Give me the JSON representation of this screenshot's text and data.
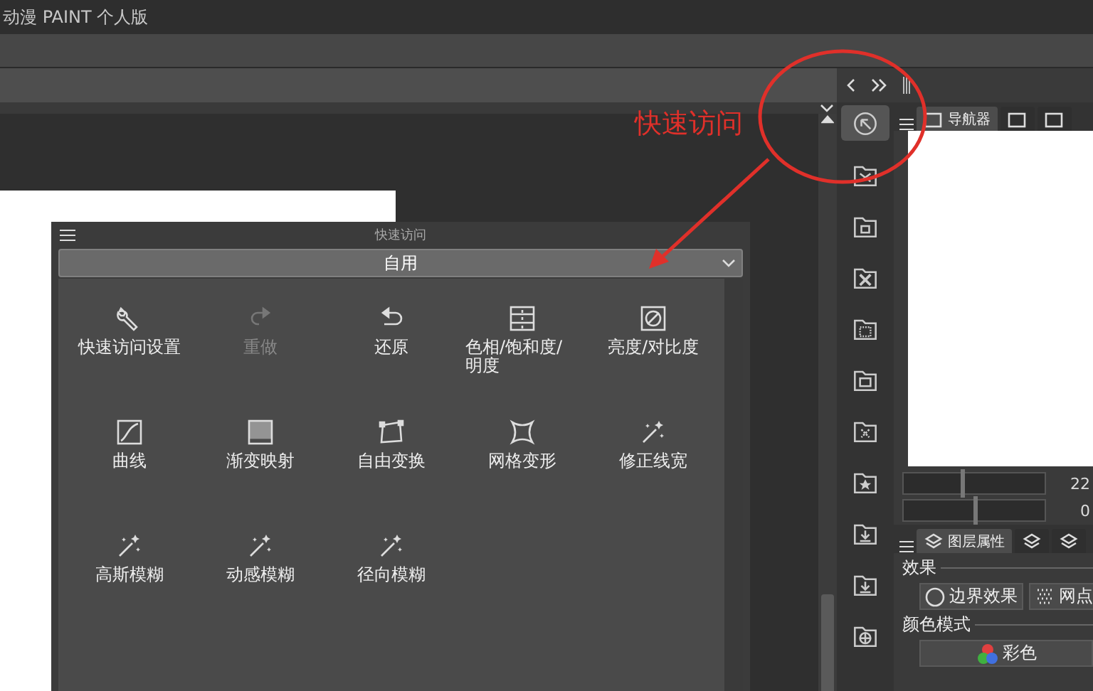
{
  "window": {
    "title": "动漫 PAINT 个人版"
  },
  "annotation": {
    "label": "快速访问"
  },
  "quick_access": {
    "title": "快速访问",
    "set": "自用",
    "items": [
      {
        "kind": "settings",
        "label": "快速访问设置",
        "disabled": false
      },
      {
        "kind": "redo",
        "label": "重做",
        "disabled": true
      },
      {
        "kind": "undo",
        "label": "还原",
        "disabled": false
      },
      {
        "kind": "hue",
        "label": "色相/饱和度/明度",
        "disabled": false
      },
      {
        "kind": "brightness",
        "label": "亮度/对比度",
        "disabled": false
      },
      {
        "kind": "curve",
        "label": "曲线",
        "disabled": false
      },
      {
        "kind": "gradient",
        "label": "渐变映射",
        "disabled": false
      },
      {
        "kind": "transform",
        "label": "自由变换",
        "disabled": false
      },
      {
        "kind": "mesh",
        "label": "网格变形",
        "disabled": false
      },
      {
        "kind": "wand",
        "label": "修正线宽",
        "disabled": false
      },
      {
        "kind": "wand",
        "label": "高斯模糊",
        "disabled": false
      },
      {
        "kind": "wand",
        "label": "动感模糊",
        "disabled": false
      },
      {
        "kind": "wand",
        "label": "径向模糊",
        "disabled": false
      }
    ]
  },
  "icon_bar": [
    {
      "selected": true
    },
    {
      "selected": false
    },
    {
      "selected": false
    },
    {
      "selected": false
    },
    {
      "selected": false
    },
    {
      "selected": false
    },
    {
      "selected": false
    },
    {
      "selected": false
    },
    {
      "selected": false
    },
    {
      "selected": false
    },
    {
      "selected": false
    }
  ],
  "navigator": {
    "tabs": [
      {
        "label": "导航器",
        "selected": true
      },
      {
        "selected": false
      },
      {
        "selected": false
      }
    ]
  },
  "sliders": [
    {
      "level": 0.41,
      "reading": "22"
    },
    {
      "level": 0.5,
      "reading": "0"
    }
  ],
  "layer_property": {
    "tabs": [
      {
        "label": "图层属性",
        "selected": true
      },
      {
        "selected": false
      },
      {
        "selected": false
      }
    ],
    "sections": [
      {
        "label": "效果",
        "buttons": [
          {
            "kind": "border",
            "label": "边界效果"
          },
          {
            "kind": "tone",
            "label": "网点"
          }
        ]
      },
      {
        "label": "颜色模式",
        "buttons": [
          {
            "kind": "color",
            "label": "彩色"
          }
        ]
      }
    ]
  }
}
